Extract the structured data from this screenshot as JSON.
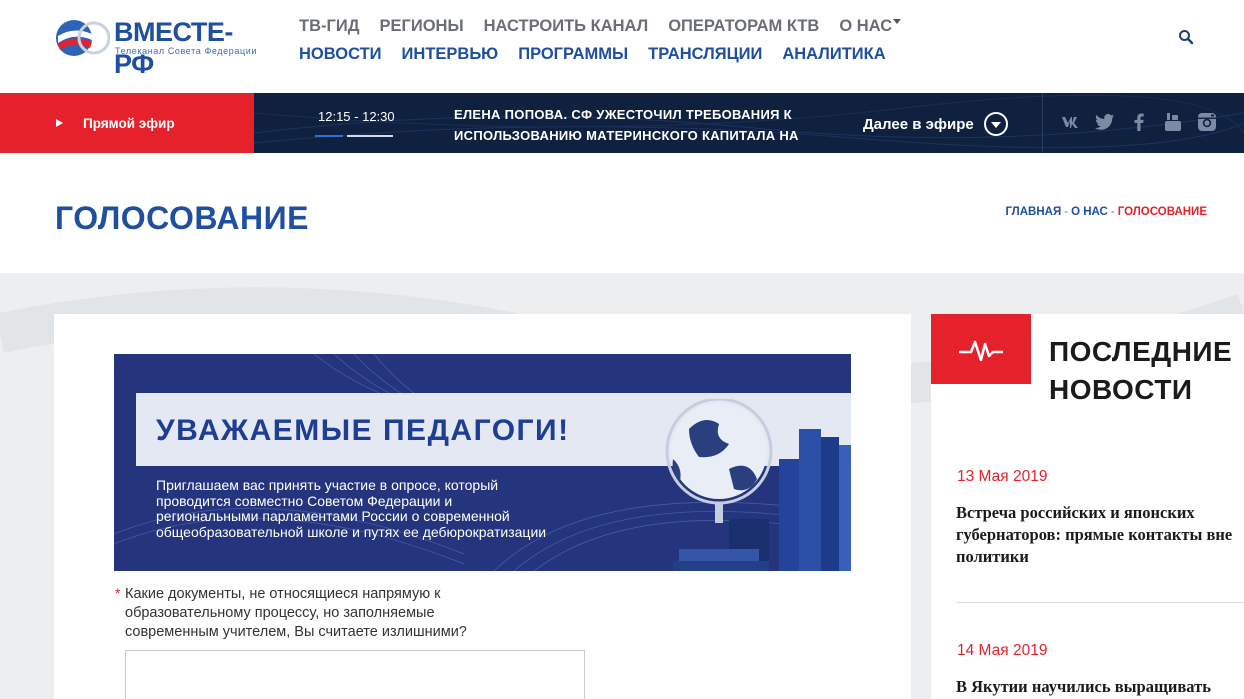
{
  "logo": {
    "title": "ВМЕСТЕ-РФ",
    "subtitle": "Телеканал Совета Федерации"
  },
  "nav": {
    "top": [
      "ТВ-ГИД",
      "РЕГИОНЫ",
      "НАСТРОИТЬ КАНАЛ",
      "ОПЕРАТОРАМ КТВ",
      "О НАС"
    ],
    "bottom": [
      "НОВОСТИ",
      "ИНТЕРВЬЮ",
      "ПРОГРАММЫ",
      "ТРАНСЛЯЦИИ",
      "АНАЛИТИКА"
    ]
  },
  "live": {
    "label": "Прямой эфир",
    "time": "12:15 - 12:30",
    "headline": "ЕЛЕНА ПОПОВА. СФ УЖЕСТОЧИЛ ТРЕБОВАНИЯ К ИСПОЛЬЗОВАНИЮ МАТЕРИНСКОГО КАПИТАЛА НА",
    "next_label": "Далее в эфире",
    "progress_fraction": 0.36
  },
  "social": [
    "vk-icon",
    "twitter-icon",
    "facebook-icon",
    "youtube-icon",
    "instagram-icon"
  ],
  "page": {
    "title": "ГОЛОСОВАНИЕ",
    "breadcrumb": [
      "ГЛАВНАЯ",
      "О НАС",
      "ГОЛОСОВАНИЕ"
    ]
  },
  "banner": {
    "title": "УВАЖАЕМЫЕ ПЕДАГОГИ!",
    "text": "Приглашаем вас принять участие в опросе, который проводится совместно Советом Федерации и региональными парламентами России о современной общеобразовательной школе и путях ее дебюрократизации"
  },
  "form": {
    "required_mark": "*",
    "question": "Какие документы, не относящиеся напрямую к образовательному процессу, но заполняемые современным учителем, Вы считаете излишними?",
    "answer_value": ""
  },
  "sidebar": {
    "heading": "ПОСЛЕДНИЕ НОВОСТИ",
    "news": [
      {
        "date": "13 Мая 2019",
        "title": "Встреча российских и японских губернаторов: прямые контакты вне политики"
      },
      {
        "date": "14 Мая 2019",
        "title": "В Якутии научились выращивать"
      }
    ]
  },
  "colors": {
    "brand_blue": "#1e4fa0",
    "accent_red": "#e5222b",
    "live_bg": "#10213f"
  }
}
